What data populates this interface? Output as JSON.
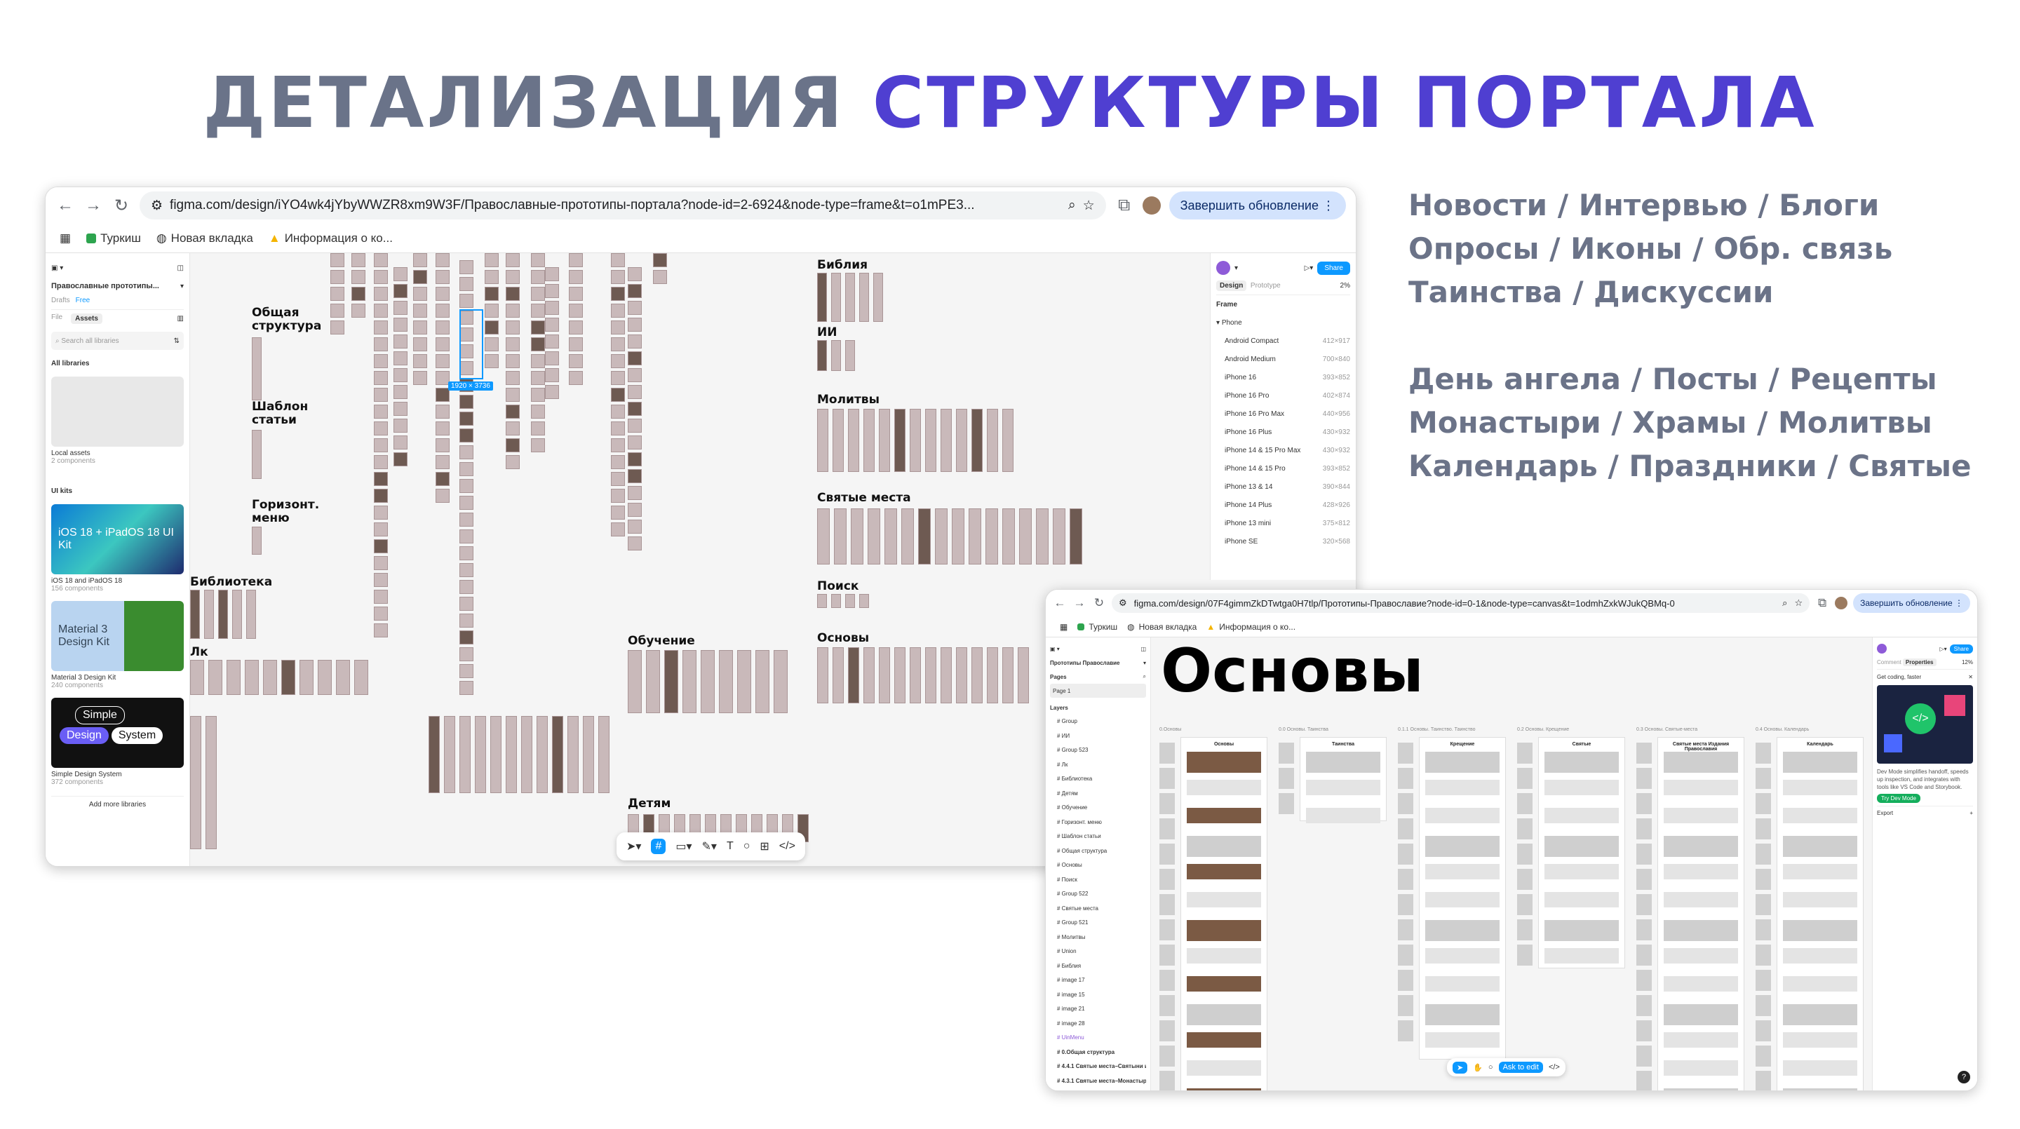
{
  "headline": {
    "part1": "ДЕТАЛИЗАЦИЯ",
    "part2": "СТРУКТУРЫ ПОРТАЛА"
  },
  "topics": {
    "group1": [
      "Новости / Интервью / Блоги",
      "Опросы / Иконы / Обр. связь",
      "Таинства / Дискуссии"
    ],
    "group2": [
      "День ангела / Посты / Рецепты",
      "Монастыри / Храмы / Молитвы",
      "Календарь / Праздники / Святые"
    ]
  },
  "colors": {
    "headline_gray": "#6a7389",
    "headline_accent": "#4f3fd1",
    "topics": "#6b7388",
    "figma_blue": "#0d99ff"
  },
  "window1": {
    "url": "figma.com/design/iYO4wk4jYbyWWZR8xm9W3F/Православные-прототипы-портала?node-id=2-6924&node-type=frame&t=o1mPE3...",
    "update_label": "Завершить обновление",
    "bookmarks": [
      "Туркиш",
      "Новая вкладка",
      "Информация о ко..."
    ],
    "left_panel": {
      "file_name": "Православные прототипы...",
      "drafts": "Drafts",
      "free": "Free",
      "tab_file": "File",
      "tab_assets": "Assets",
      "search_placeholder": "Search all libraries",
      "all_libraries": "All libraries",
      "local_assets": "Local assets",
      "local_components": "2 components",
      "ui_kits": "UI kits",
      "ios_tile": "iOS 18 + iPadOS 18 UI Kit",
      "ios_name": "iOS 18 and iPadOS 18",
      "ios_count": "156 components",
      "mat_tile": "Material 3 Design Kit",
      "mat_name": "Material 3 Design Kit",
      "mat_count": "240 components",
      "sds_tile1": "Simple",
      "sds_tile2": "Design",
      "sds_tile3": "System",
      "sds_name": "Simple Design System",
      "sds_count": "372 components",
      "add_more": "Add more libraries"
    },
    "right_panel": {
      "share": "Share",
      "tab_design": "Design",
      "tab_prototype": "Prototype",
      "zoom": "2%",
      "frame_heading": "Frame",
      "group": "Phone",
      "devices": [
        {
          "name": "Android Compact",
          "size": "412×917"
        },
        {
          "name": "Android Medium",
          "size": "700×840"
        },
        {
          "name": "iPhone 16",
          "size": "393×852"
        },
        {
          "name": "iPhone 16 Pro",
          "size": "402×874"
        },
        {
          "name": "iPhone 16 Pro Max",
          "size": "440×956"
        },
        {
          "name": "iPhone 16 Plus",
          "size": "430×932"
        },
        {
          "name": "iPhone 14 & 15 Pro Max",
          "size": "430×932"
        },
        {
          "name": "iPhone 14 & 15 Pro",
          "size": "393×852"
        },
        {
          "name": "iPhone 13 & 14",
          "size": "390×844"
        },
        {
          "name": "iPhone 14 Plus",
          "size": "428×926"
        },
        {
          "name": "iPhone 13 mini",
          "size": "375×812"
        },
        {
          "name": "iPhone SE",
          "size": "320×568"
        }
      ]
    },
    "selection_size": "1920 × 3736",
    "canvas_labels": {
      "obshaya": "Общая структура",
      "shablon": "Шаблон статьи",
      "gorizont": "Горизонт. меню",
      "biblioteka": "Библиотека",
      "lk": "Лк",
      "obuchenie": "Обучение",
      "detyam": "Детям",
      "bibliya": "Библия",
      "ii": "ИИ",
      "molitvy": "Молитвы",
      "svyatye": "Святые места",
      "poisk": "Поиск",
      "osnovy": "Основы"
    }
  },
  "window2": {
    "url": "figma.com/design/07F4gimmZkDTwtga0H7tlp/Прототипы-Православие?node-id=0-1&node-type=canvas&t=1odmhZxkWJukQBMq-0",
    "update_label": "Завершить обновление",
    "bookmarks": [
      "Туркиш",
      "Новая вкладка",
      "Информация о ко..."
    ],
    "file_name": "Прототипы Православие",
    "pages_label": "Pages",
    "page1": "Page 1",
    "layers_label": "Layers",
    "layers": [
      "Group",
      "ИИ",
      "Group 523",
      "Лк",
      "Библиотека",
      "Детям",
      "Обучение",
      "Горизонт. меню",
      "Шаблон статьи",
      "Общая структура",
      "Основы",
      "Поиск",
      "Group 522",
      "Святые места",
      "Group 521",
      "Молитвы",
      "Union",
      "Библия",
      "image 17",
      "image 15",
      "image 21",
      "image 28",
      "UinMenu",
      "0.Общая структура",
      "4.4.1 Святые места–Святыни и реликвии",
      "4.3.1 Святые места–Монастыри-Мон"
    ],
    "canvas_title": "Основы",
    "frame_titles": [
      "0.Основы",
      "0.0 Основы. Таинства",
      "0.1.1 Основы. Таинство. Таинство",
      "0.2 Основы. Крещение",
      "0.3 Основы. Святые-места",
      "0.4 Основы. Календарь"
    ],
    "card_titles": [
      "Основы",
      "Таинства",
      "Крещение",
      "Святые",
      "Святые места Издания Православия",
      "Календарь"
    ],
    "right_panel": {
      "share": "Share",
      "tab_comment": "Comment",
      "tab_properties": "Properties",
      "zoom": "12%",
      "promo_title": "Get coding, faster",
      "promo_text": "Dev Mode simplifies handoff, speeds up inspection, and integrates with tools like VS Code and Storybook.",
      "promo_button": "Try Dev Mode",
      "export": "Export"
    },
    "toolbar_action": "Ask to edit"
  }
}
